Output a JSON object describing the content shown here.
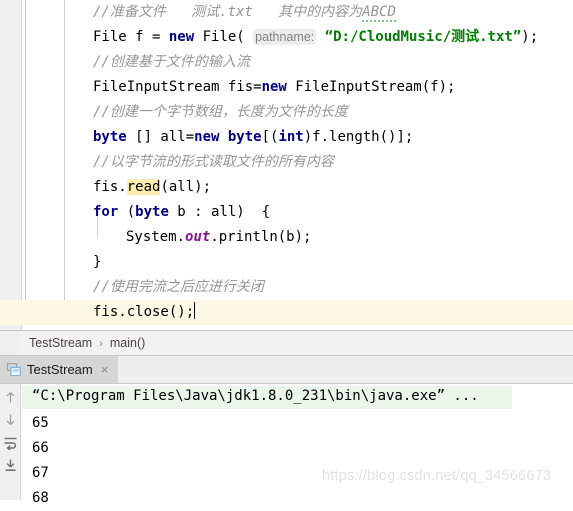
{
  "editor": {
    "lines": [
      {
        "indent": 0,
        "segments": [
          {
            "kind": "comment",
            "text": "//准备文件   测试.txt   其中的内容为"
          },
          {
            "kind": "spell",
            "text": "ABCD"
          }
        ]
      },
      {
        "indent": 0,
        "segments": [
          {
            "kind": "plain",
            "text": "File f = "
          },
          {
            "kind": "keyword",
            "text": "new"
          },
          {
            "kind": "plain",
            "text": " File( "
          },
          {
            "kind": "hint",
            "text": "pathname:"
          },
          {
            "kind": "plain",
            "text": " "
          },
          {
            "kind": "string",
            "text": "“D:/CloudMusic/测试.txt”"
          },
          {
            "kind": "plain",
            "text": ");"
          }
        ]
      },
      {
        "indent": 0,
        "segments": [
          {
            "kind": "comment",
            "text": "//创建基于文件的输入流"
          }
        ]
      },
      {
        "indent": 0,
        "segments": [
          {
            "kind": "plain",
            "text": "FileInputStream fis="
          },
          {
            "kind": "keyword",
            "text": "new"
          },
          {
            "kind": "plain",
            "text": " FileInputStream(f);"
          }
        ]
      },
      {
        "indent": 0,
        "segments": [
          {
            "kind": "comment",
            "text": "//创建一个字节数组，长度为文件的长度"
          }
        ]
      },
      {
        "indent": 0,
        "segments": [
          {
            "kind": "keyword",
            "text": "byte"
          },
          {
            "kind": "plain",
            "text": " [] all="
          },
          {
            "kind": "keyword",
            "text": "new byte"
          },
          {
            "kind": "plain",
            "text": "[("
          },
          {
            "kind": "keyword",
            "text": "int"
          },
          {
            "kind": "plain",
            "text": ")f.length()];"
          }
        ]
      },
      {
        "indent": 0,
        "segments": [
          {
            "kind": "comment",
            "text": "//以字节流的形式读取文件的所有内容"
          }
        ]
      },
      {
        "indent": 0,
        "segments": [
          {
            "kind": "plain",
            "text": "fis."
          },
          {
            "kind": "highlight",
            "text": "read"
          },
          {
            "kind": "plain",
            "text": "(all);"
          }
        ]
      },
      {
        "indent": 0,
        "segments": [
          {
            "kind": "keyword",
            "text": "for"
          },
          {
            "kind": "plain",
            "text": " ("
          },
          {
            "kind": "keyword",
            "text": "byte"
          },
          {
            "kind": "plain",
            "text": " b : all)  {"
          }
        ]
      },
      {
        "indent": 1,
        "segments": [
          {
            "kind": "plain",
            "text": "System."
          },
          {
            "kind": "static",
            "text": "out"
          },
          {
            "kind": "plain",
            "text": ".println(b);"
          }
        ]
      },
      {
        "indent": 0,
        "segments": [
          {
            "kind": "plain",
            "text": "}"
          }
        ]
      },
      {
        "indent": 0,
        "segments": [
          {
            "kind": "comment",
            "text": "//使用完流之后应进行关闭"
          }
        ]
      },
      {
        "indent": 0,
        "current": true,
        "segments": [
          {
            "kind": "plain",
            "text": "fis.close();"
          },
          {
            "kind": "caret",
            "text": ""
          }
        ]
      },
      {
        "indent": -1,
        "segments": [
          {
            "kind": "plain",
            "text": "}"
          }
        ]
      },
      {
        "indent": -2,
        "segments": [
          {
            "kind": "plain",
            "text": "}"
          }
        ]
      }
    ],
    "fold_marker_icon": "fold-collapse-icon",
    "colors": {
      "keyword": "#000080",
      "string": "#008000",
      "comment": "#969696",
      "static_field": "#871094",
      "current_line_bg": "#fdf8e3",
      "identifier_highlight_bg": "#fbeeb0",
      "parameter_hint_bg": "#ededed"
    }
  },
  "breadcrumb": {
    "items": [
      "TestStream",
      "main()"
    ],
    "separator": "›"
  },
  "run_window": {
    "tab": {
      "label": "TestStream",
      "icon": "console-window-icon",
      "close_label": "×"
    },
    "toolbar_icons": [
      "arrow-up-icon",
      "arrow-down-icon",
      "soft-wrap-icon",
      "scroll-to-end-icon"
    ],
    "console": {
      "command_line": "“C:\\Program Files\\Java\\jdk1.8.0_231\\bin\\java.exe” ...",
      "command_line_bg": "#e9f6e9",
      "output": [
        "65",
        "66",
        "67",
        "68"
      ]
    }
  },
  "watermark": "https://blog.csdn.net/qq_34566673"
}
